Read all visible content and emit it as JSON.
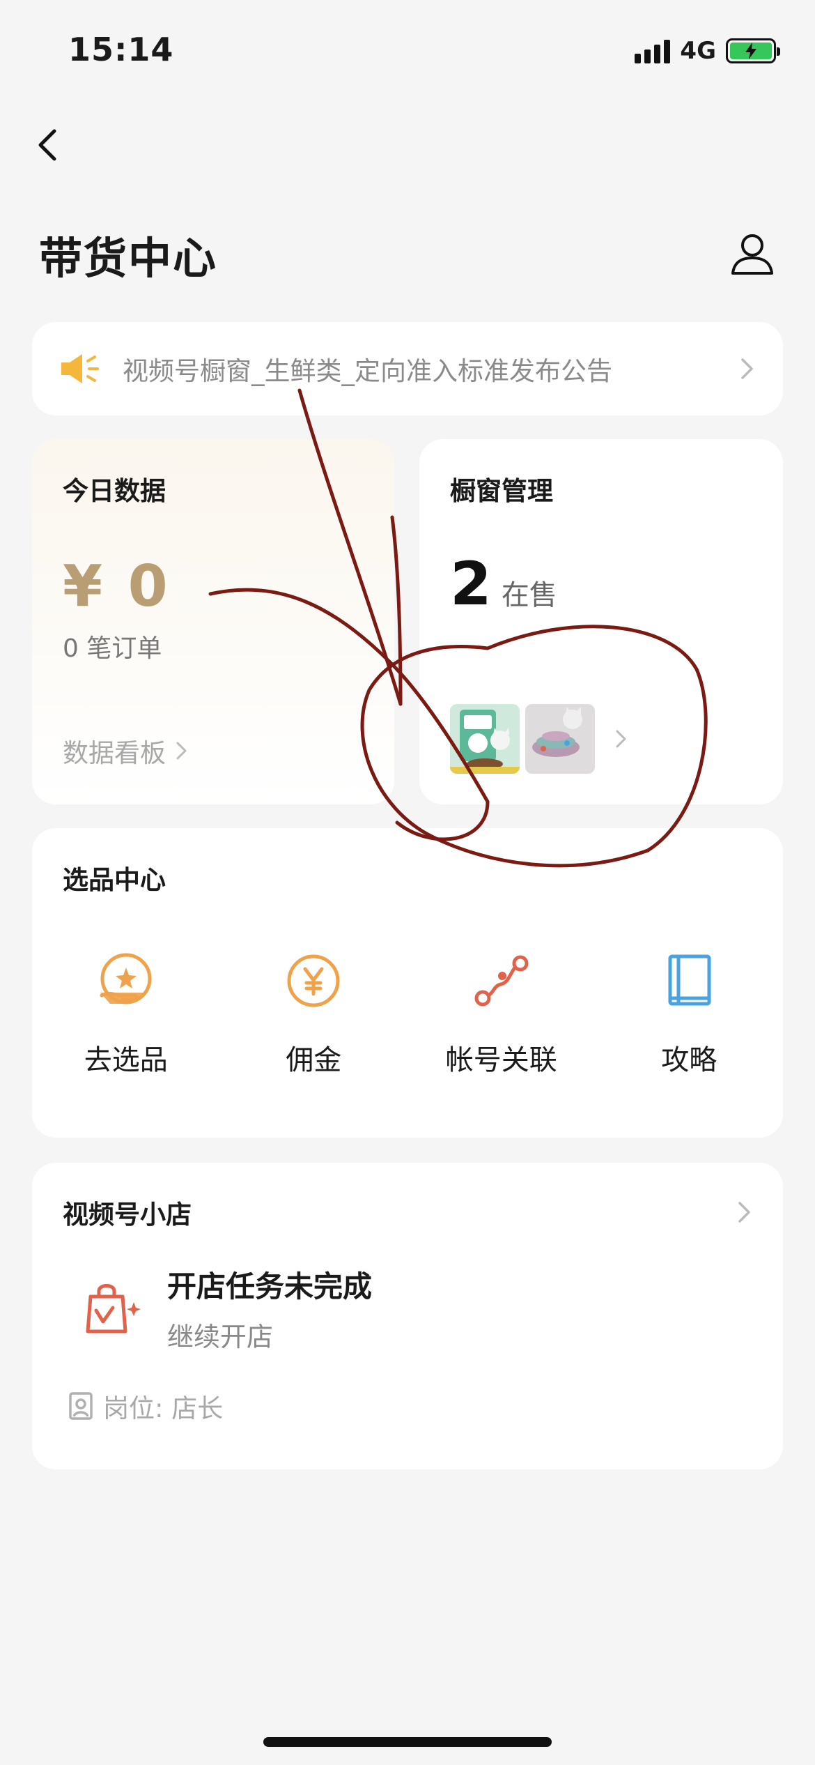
{
  "status_bar": {
    "time": "15:14",
    "network": "4G"
  },
  "header": {
    "title": "带货中心"
  },
  "notice": {
    "text": "视频号橱窗_生鲜类_定向准入标准发布公告"
  },
  "today_data": {
    "title": "今日数据",
    "amount": "¥ 0",
    "orders": "0 笔订单",
    "dashboard_link": "数据看板"
  },
  "window_management": {
    "title": "橱窗管理",
    "count": "2",
    "count_unit": "在售"
  },
  "selection_center": {
    "title": "选品中心",
    "items": [
      {
        "label": "去选品",
        "icon": "hand-star-icon"
      },
      {
        "label": "佣金",
        "icon": "yen-coin-icon"
      },
      {
        "label": "帐号关联",
        "icon": "link-nodes-icon"
      },
      {
        "label": "攻略",
        "icon": "book-icon"
      }
    ]
  },
  "shop": {
    "title": "视频号小店",
    "task_title": "开店任务未完成",
    "task_sub": "继续开店",
    "role": "岗位: 店长"
  },
  "colors": {
    "accent_gold": "#b89e72",
    "icon_orange": "#f0a24b",
    "icon_red": "#e0624a",
    "icon_blue": "#4aa3df",
    "annotation": "#7a1a12"
  }
}
